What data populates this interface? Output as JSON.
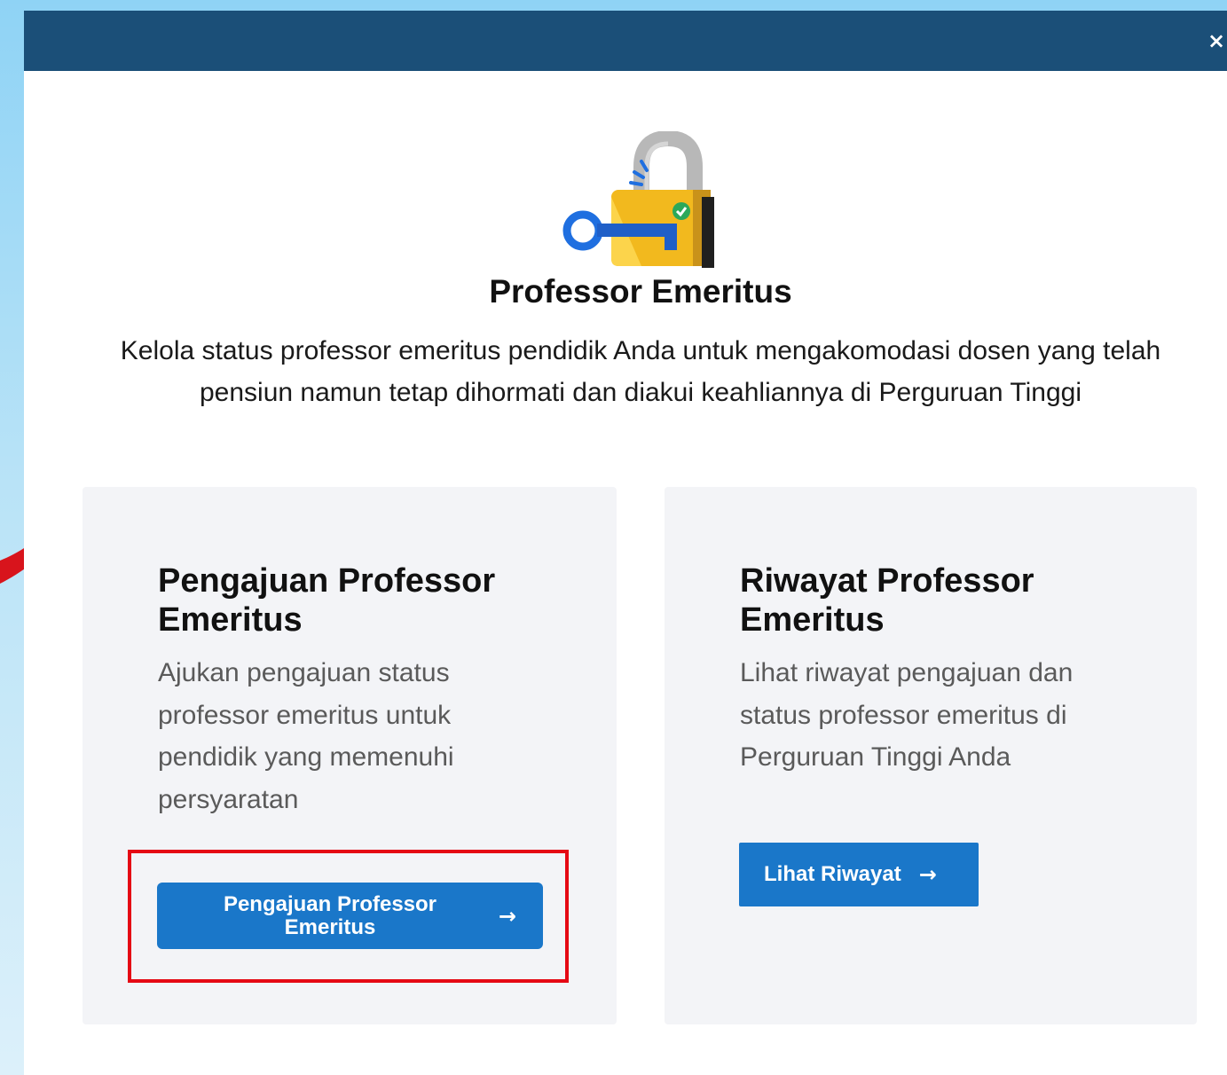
{
  "modal": {
    "close_label": "×",
    "title": "Professor Emeritus",
    "subtitle": "Kelola status professor emeritus pendidik Anda untuk mengakomodasi dosen yang telah pensiun namun tetap dihormati dan diakui keahliannya di Perguruan Tinggi",
    "hero_icon": "padlock-key-icon"
  },
  "cards": [
    {
      "title": "Pengajuan Professor Emeritus",
      "description": "Ajukan pengajuan status professor emeritus untuk pendidik yang memenuhi persyaratan",
      "button_label": "Pengajuan Professor Emeritus",
      "button_icon": "arrow-right-icon"
    },
    {
      "title": "Riwayat Professor Emeritus",
      "description": "Lihat riwayat pengajuan dan status professor emeritus di Perguruan Tinggi Anda",
      "button_label": "Lihat Riwayat",
      "button_icon": "arrow-right-icon"
    }
  ],
  "colors": {
    "header": "#1b4f78",
    "button": "#1a77c9",
    "card_bg": "#f3f4f7",
    "highlight": "#e50914",
    "page_bg": "#8fd3f5"
  }
}
